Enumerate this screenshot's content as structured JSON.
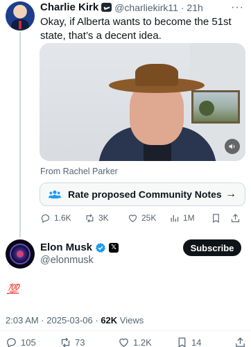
{
  "quoted_tweet": {
    "author_name": "Charlie Kirk",
    "handle_time": "@charliekirk11 · 21h",
    "text": "Okay, if Alberta wants to become the 51st state, that’s a decent idea.",
    "media_source": "From Rachel Parker",
    "community_notes_label": "Rate proposed Community Notes",
    "community_notes_arrow": "→",
    "stats": {
      "replies": "1.6K",
      "reposts": "3K",
      "likes": "25K",
      "views": "1M"
    }
  },
  "main_tweet": {
    "author_name": "Elon Musk",
    "badge_x": "𝕏",
    "handle": "@elonmusk",
    "subscribe_label": "Subscribe",
    "text": "💯",
    "meta": {
      "time_date": "2:03 AM · 2025-03-06 · ",
      "views_count": "62K",
      "views_label": " Views"
    },
    "stats": {
      "replies": "105",
      "reposts": "73",
      "likes": "1.2K",
      "bookmarks": "14"
    }
  },
  "icons": {
    "reply": "reply-icon",
    "repost": "repost-icon",
    "like": "heart-icon",
    "views": "views-icon",
    "bookmark": "bookmark-icon",
    "share": "share-icon",
    "verified": "verified-badge-icon",
    "more": "more-icon",
    "sound": "speaker-icon",
    "community": "people-icon"
  },
  "colors": {
    "accent_blue": "#1d9bf0",
    "text_primary": "#0f1419",
    "text_secondary": "#536471"
  }
}
